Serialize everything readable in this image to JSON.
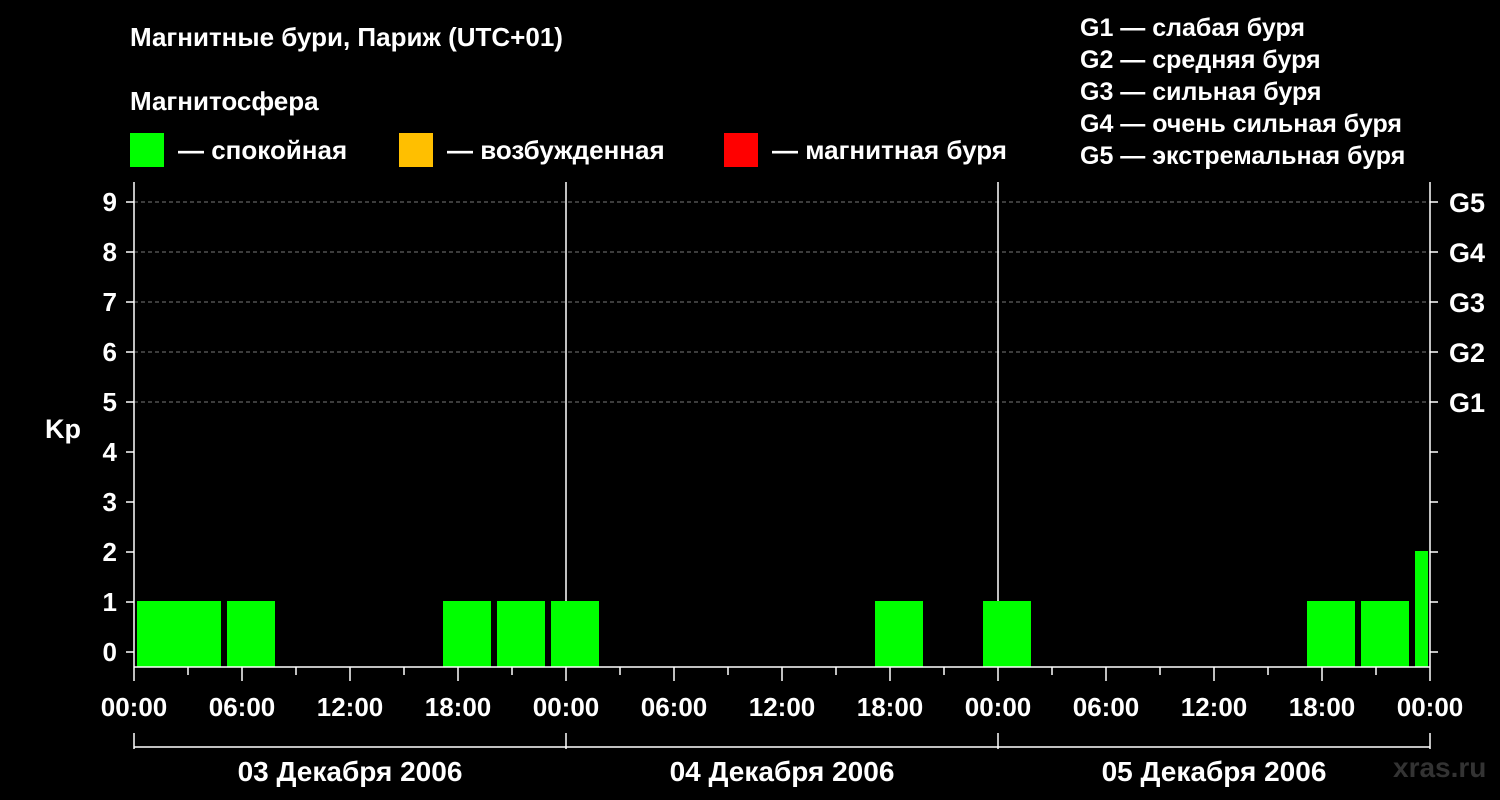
{
  "header": {
    "title": "Магнитные бури, Париж (UTC+01)",
    "subtitle": "Магнитосфера"
  },
  "legend": [
    {
      "color": "#00ff00",
      "label": "— спокойная"
    },
    {
      "color": "#ffbf00",
      "label": "— возбужденная"
    },
    {
      "color": "#ff0000",
      "label": "— магнитная буря"
    }
  ],
  "storm_levels": [
    "G1 — слабая буря",
    "G2 — средняя буря",
    "G3 — сильная буря",
    "G4 — очень сильная буря",
    "G5 — экстремальная буря"
  ],
  "watermark": "xras.ru",
  "chart_data": {
    "type": "bar",
    "ylabel": "Kp",
    "ylim": [
      0,
      9
    ],
    "y_ticks": [
      "0",
      "1",
      "2",
      "3",
      "4",
      "5",
      "6",
      "7",
      "8",
      "9"
    ],
    "right_axis_labels": [
      {
        "kp": 5,
        "label": "G1"
      },
      {
        "kp": 6,
        "label": "G2"
      },
      {
        "kp": 7,
        "label": "G3"
      },
      {
        "kp": 8,
        "label": "G4"
      },
      {
        "kp": 9,
        "label": "G5"
      }
    ],
    "x_tick_labels": [
      "00:00",
      "06:00",
      "12:00",
      "18:00",
      "00:00",
      "06:00",
      "12:00",
      "18:00",
      "00:00",
      "06:00",
      "12:00",
      "18:00",
      "00:00"
    ],
    "days": [
      "03 Декабря 2006",
      "04 Декабря 2006",
      "05 Декабря 2006"
    ],
    "grid": "dashed horizontal at Kp 5–9",
    "series": [
      {
        "values": [
          {
            "start": "03 00:00",
            "kp": 1,
            "color": "#00ff00"
          },
          {
            "start": "03 02:00",
            "kp": 1,
            "color": "#00ff00"
          },
          {
            "start": "03 05:00",
            "kp": 1,
            "color": "#00ff00"
          },
          {
            "start": "03 17:00",
            "kp": 1,
            "color": "#00ff00"
          },
          {
            "start": "03 20:00",
            "kp": 1,
            "color": "#00ff00"
          },
          {
            "start": "03 23:00",
            "kp": 1,
            "color": "#00ff00"
          },
          {
            "start": "04 17:00",
            "kp": 1,
            "color": "#00ff00"
          },
          {
            "start": "04 23:00",
            "kp": 1,
            "color": "#00ff00"
          },
          {
            "start": "05 17:00",
            "kp": 1,
            "color": "#00ff00"
          },
          {
            "start": "05 20:00",
            "kp": 1,
            "color": "#00ff00"
          },
          {
            "start": "05 23:00",
            "kp": 2,
            "color": "#00ff00"
          }
        ]
      }
    ]
  }
}
